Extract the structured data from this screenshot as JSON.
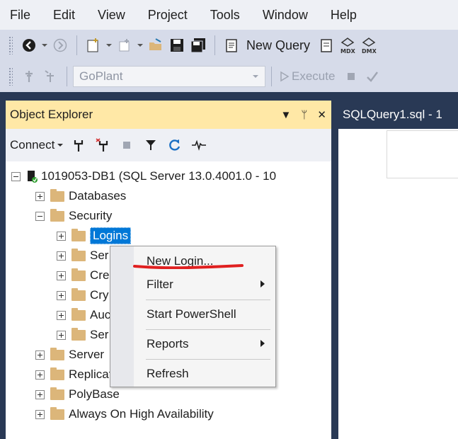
{
  "menu": [
    "File",
    "Edit",
    "View",
    "Project",
    "Tools",
    "Window",
    "Help"
  ],
  "toolbar1": {
    "new_query_label": "New Query",
    "mdx_label": "MDX",
    "dmx_label": "DMX"
  },
  "toolbar2": {
    "database_combo_value": "GoPlant",
    "execute_label": "Execute"
  },
  "object_explorer": {
    "title": "Object Explorer",
    "controls": {
      "dropdown": "▼",
      "pin": "ᛘ",
      "close": "✕"
    },
    "connect_label": "Connect",
    "tree": {
      "server": "1019053-DB1 (SQL Server 13.0.4001.0 - 10",
      "databases": "Databases",
      "security": "Security",
      "logins": "Logins",
      "sec_child_2": "Ser",
      "sec_child_3": "Cre",
      "sec_child_4": "Cry",
      "sec_child_5": "Auc",
      "sec_child_6": "Ser",
      "server_objects": "Server",
      "replication": "Replication",
      "polybase": "PolyBase",
      "always_on": "Always On High Availability"
    }
  },
  "document_tab": {
    "title": "SQLQuery1.sql - 1"
  },
  "context_menu": {
    "items": [
      "New Login...",
      "Filter",
      "Start PowerShell",
      "Reports",
      "Refresh"
    ]
  },
  "colors": {
    "selection": "#0078d7",
    "title_bar": "#ffe8a6",
    "annotation": "#e02020",
    "frame": "#293955"
  }
}
